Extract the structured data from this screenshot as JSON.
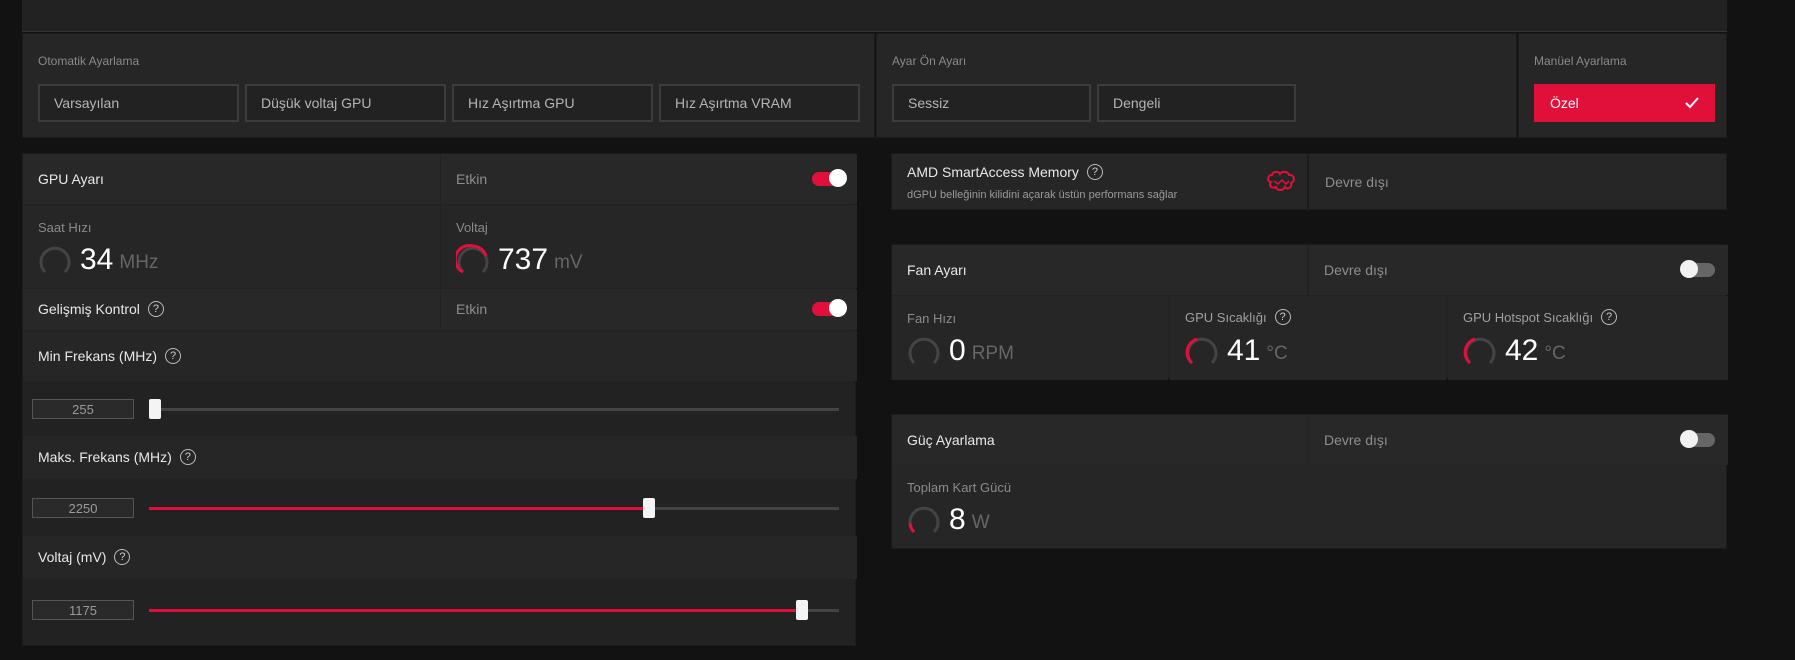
{
  "auto_tuning": {
    "title": "Otomatik Ayarlama",
    "buttons": [
      "Varsayılan",
      "Düşük voltaj GPU",
      "Hız Aşırtma GPU",
      "Hız Aşırtma VRAM"
    ]
  },
  "preset": {
    "title": "Ayar Ön Ayarı",
    "buttons": [
      "Sessiz",
      "Dengeli"
    ]
  },
  "manual": {
    "title": "Manüel Ayarlama",
    "button": "Özel"
  },
  "gpu": {
    "title": "GPU Ayarı",
    "state": "Etkin",
    "clock_label": "Saat Hızı",
    "clock_value": "34",
    "clock_unit": "MHz",
    "voltage_label": "Voltaj",
    "voltage_value": "737",
    "voltage_unit": "mV",
    "advanced_label": "Gelişmiş Kontrol",
    "advanced_state": "Etkin",
    "min_freq_label": "Min Frekans (MHz)",
    "min_freq_value": "255",
    "min_freq_fraction": 0,
    "max_freq_label": "Maks. Frekans (MHz)",
    "max_freq_value": "2250",
    "max_freq_fraction": 0.725,
    "voltage_mv_label": "Voltaj (mV)",
    "voltage_mv_value": "1175",
    "voltage_mv_fraction": 0.946
  },
  "sam": {
    "title": "AMD SmartAccess Memory",
    "desc": "dGPU belleğinin kilidini açarak üstün performans sağlar",
    "state": "Devre dışı",
    "icon": "brain-icon"
  },
  "fan": {
    "title": "Fan Ayarı",
    "state": "Devre dışı",
    "speed_label": "Fan Hızı",
    "speed_value": "0",
    "speed_unit": "RPM",
    "temp_label": "GPU Sıcaklığı",
    "temp_value": "41",
    "temp_unit": "°C",
    "hotspot_label": "GPU Hotspot Sıcaklığı",
    "hotspot_value": "42",
    "hotspot_unit": "°C"
  },
  "power": {
    "title": "Güç Ayarlama",
    "state": "Devre dışı",
    "total_label": "Toplam Kart Gücü",
    "total_value": "8",
    "total_unit": "W"
  },
  "colors": {
    "accent": "#e0103a",
    "panel": "#262626",
    "background": "#121212"
  }
}
